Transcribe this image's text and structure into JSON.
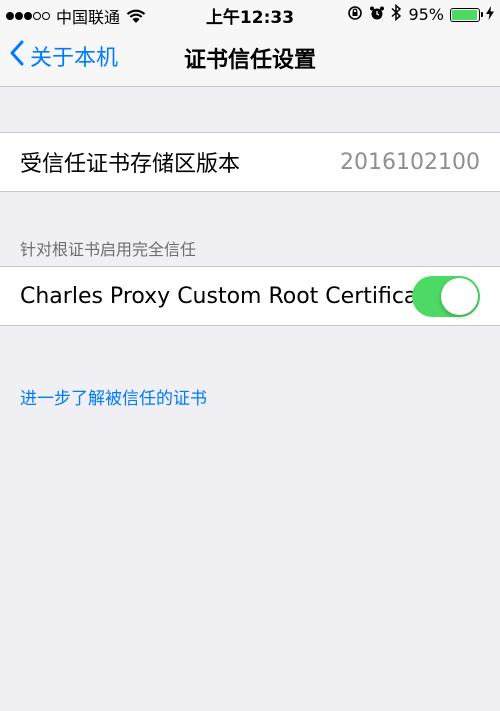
{
  "status_bar": {
    "carrier": "中国联通",
    "time": "上午12:33",
    "battery_percent": "95%",
    "battery_level": 0.95,
    "signal_bars_filled": 3,
    "signal_bars_total": 5
  },
  "nav": {
    "back_label": "关于本机",
    "title": "证书信任设置"
  },
  "trust_store": {
    "label": "受信任证书存储区版本",
    "value": "2016102100"
  },
  "full_trust_section": {
    "header": "针对根证书启用完全信任",
    "items": [
      {
        "label": "Charles Proxy Custom Root Certifica...",
        "enabled": true
      }
    ]
  },
  "footer_link": "进一步了解被信任的证书",
  "colors": {
    "accent": "#007aff",
    "toggle_on": "#4cd964",
    "background": "#efeff4"
  }
}
